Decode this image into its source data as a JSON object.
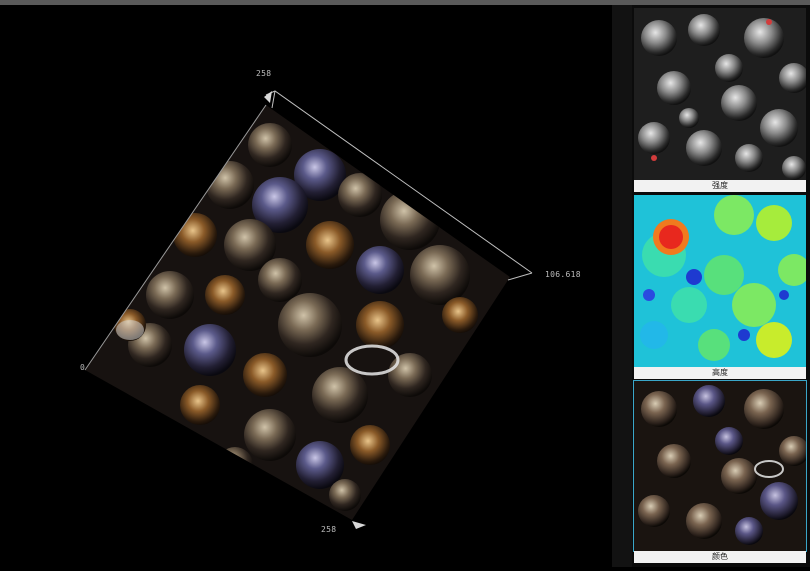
{
  "viewer": {
    "axis_top": "258",
    "axis_right": "106.618",
    "axis_bottom": "258",
    "axis_left_corner": "0"
  },
  "thumbnails": [
    {
      "label": "强度",
      "mode": "intensity",
      "selected": false
    },
    {
      "label": "高度",
      "mode": "height",
      "selected": false
    },
    {
      "label": "颜色",
      "mode": "color",
      "selected": true
    }
  ],
  "colors": {
    "background": "#000000",
    "selection_outline": "#3aa6c8",
    "label_bg": "#f2f2f2"
  }
}
